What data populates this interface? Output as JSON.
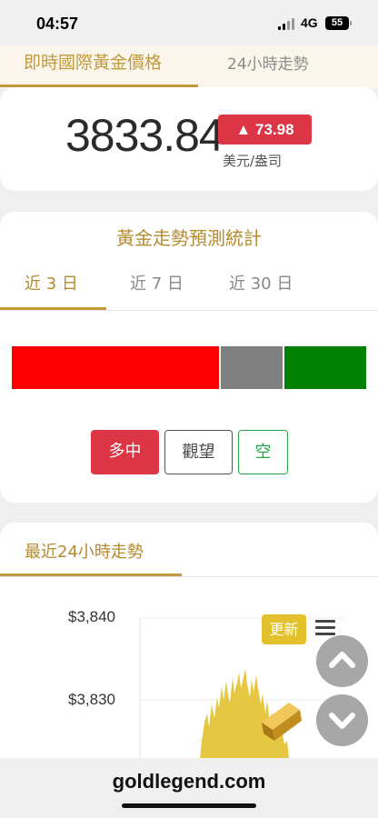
{
  "status_bar": {
    "time": "04:57",
    "network": "4G",
    "battery": "55"
  },
  "top_tabs": {
    "realtime": "即時國際黃金價格",
    "trend24": "24小時走勢"
  },
  "price_card": {
    "price": "3833.84",
    "change": "▲ 73.98",
    "change_color": "#dc3545",
    "unit": "美元/盎司"
  },
  "forecast": {
    "title": "黃金走勢預測統計",
    "tabs": [
      {
        "label": "近 3 日",
        "active": true
      },
      {
        "label": "近 7 日",
        "active": false
      },
      {
        "label": "近 30 日",
        "active": false
      }
    ],
    "distribution": [
      {
        "key": "long",
        "share": 0.59,
        "color": "#ff0000"
      },
      {
        "key": "watch",
        "share": 0.18,
        "color": "#808080"
      },
      {
        "key": "short",
        "share": 0.23,
        "color": "#008000"
      }
    ],
    "buttons": {
      "long": "多中",
      "watch": "觀望",
      "short": "空"
    }
  },
  "recent": {
    "title": "最近24小時走勢",
    "y_ticks": [
      "$3,840",
      "$3,830"
    ],
    "refresh_label": "更新",
    "menu_icon": "hamburger-icon",
    "series_color": "#e3c12c"
  },
  "scroll_buttons": {
    "up_icon": "chevron-up-icon",
    "down_icon": "chevron-down-icon"
  },
  "footer": {
    "url": "goldlegend.com"
  }
}
